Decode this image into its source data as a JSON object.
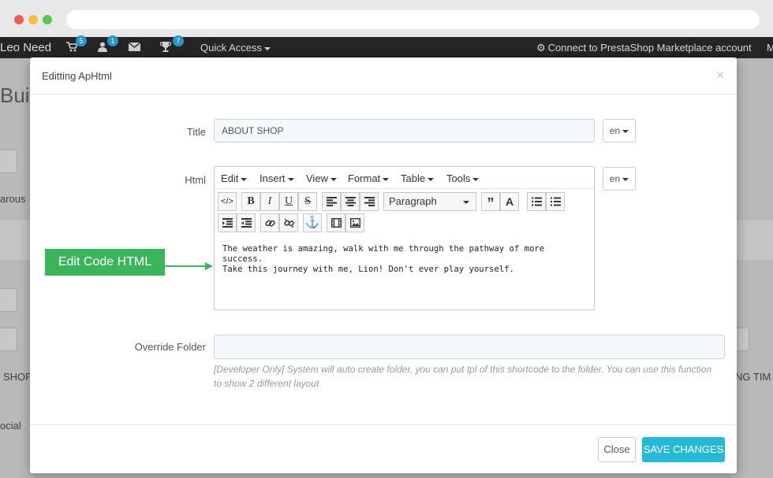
{
  "colors": {
    "accent": "#25b9d7",
    "callout": "#3ab55c",
    "admin_bar": "#252525",
    "badge": "#2a93c9"
  },
  "adminbar": {
    "shop_name": "Leo Need",
    "cart_badge": "5",
    "user_badge": "1",
    "trophy_badge": "7",
    "quick_access": "Quick Access",
    "connect_label": "Connect to PrestaShop Marketplace account",
    "truncated": "M"
  },
  "background": {
    "title_partial": "Bui",
    "row1_partial": "arous",
    "row2_partial": "SHOP",
    "row3_partial": "ocial",
    "right_partial": "NG TIM"
  },
  "modal": {
    "title": "Editting ApHtml",
    "title_label": "Title",
    "title_value": "ABOUT SHOP",
    "lang": "en",
    "html_label": "Html",
    "override_label": "Override Folder",
    "override_value": "",
    "hint": "[Developer Only] System will auto create folder, you can put tpl of this shortcode to the folder. You can use this function to show 2 different layout",
    "close_label": "Close",
    "save_label": "SAVE CHANGES"
  },
  "editor": {
    "menus": [
      "Edit",
      "Insert",
      "View",
      "Format",
      "Table",
      "Tools"
    ],
    "format_select": "Paragraph",
    "content_line1": "The weather is amazing, walk with me through the pathway of more success.",
    "content_line2": "Take this journey with me, Lion! Don't ever play yourself."
  },
  "annotation": {
    "label": "Edit Code HTML"
  }
}
